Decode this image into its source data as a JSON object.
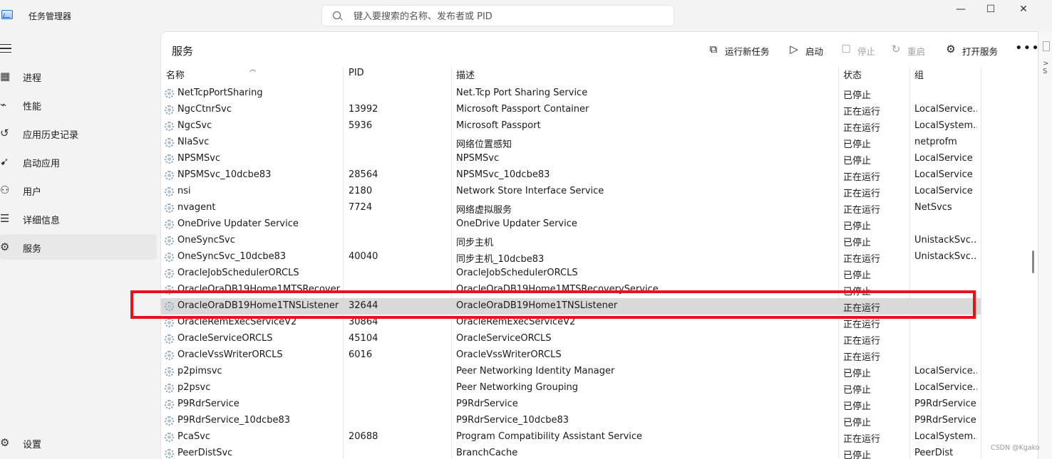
{
  "app": {
    "title": "任务管理器",
    "search_placeholder": "键入要搜索的名称、发布者或 PID",
    "window_controls": [
      "—",
      "☐",
      "✕"
    ]
  },
  "nav": {
    "items": [
      {
        "icon": "processes-icon",
        "label": "进程",
        "active": false
      },
      {
        "icon": "performance-icon",
        "label": "性能",
        "active": false
      },
      {
        "icon": "history-icon",
        "label": "应用历史记录",
        "active": false
      },
      {
        "icon": "startup-icon",
        "label": "启动应用",
        "active": false
      },
      {
        "icon": "users-icon",
        "label": "用户",
        "active": false
      },
      {
        "icon": "details-icon",
        "label": "详细信息",
        "active": false
      },
      {
        "icon": "services-icon",
        "label": "服务",
        "active": true
      }
    ],
    "settings_label": "设置"
  },
  "toolbar": {
    "page_title": "服务",
    "run_new_task": "运行新任务",
    "start": "启动",
    "stop": "停止",
    "restart": "重启",
    "open_services": "打开服务",
    "more": "•••"
  },
  "table": {
    "columns": [
      "名称",
      "PID",
      "描述",
      "状态",
      "组"
    ],
    "rows": [
      [
        "NetTcpPortSharing",
        "",
        "Net.Tcp Port Sharing Service",
        "已停止",
        ""
      ],
      [
        "NgcCtnrSvc",
        "13992",
        "Microsoft Passport Container",
        "正在运行",
        "LocalService..."
      ],
      [
        "NgcSvc",
        "5936",
        "Microsoft Passport",
        "正在运行",
        "LocalSystem..."
      ],
      [
        "NlaSvc",
        "",
        "网络位置感知",
        "已停止",
        "netprofm"
      ],
      [
        "NPSMSvc",
        "",
        "NPSMSvc",
        "已停止",
        "LocalService"
      ],
      [
        "NPSMSvc_10dcbe83",
        "28564",
        "NPSMSvc_10dcbe83",
        "正在运行",
        "LocalService"
      ],
      [
        "nsi",
        "2180",
        "Network Store Interface Service",
        "正在运行",
        "LocalService"
      ],
      [
        "nvagent",
        "7724",
        "网络虚拟服务",
        "正在运行",
        "NetSvcs"
      ],
      [
        "OneDrive Updater Service",
        "",
        "OneDrive Updater Service",
        "已停止",
        ""
      ],
      [
        "OneSyncSvc",
        "",
        "同步主机",
        "已停止",
        "UnistackSvc..."
      ],
      [
        "OneSyncSvc_10dcbe83",
        "40040",
        "同步主机_10dcbe83",
        "正在运行",
        "UnistackSvc..."
      ],
      [
        "OracleJobSchedulerORCLS",
        "",
        "OracleJobSchedulerORCLS",
        "已停止",
        ""
      ],
      [
        "OracleOraDB19Home1MTSRecover",
        "",
        "OracleOraDB19Home1MTSRecoveryService",
        "已停止",
        ""
      ],
      [
        "OracleOraDB19Home1TNSListener",
        "32644",
        "OracleOraDB19Home1TNSListener",
        "正在运行",
        ""
      ],
      [
        "OracleRemExecServiceV2",
        "30864",
        "OracleRemExecServiceV2",
        "正在运行",
        ""
      ],
      [
        "OracleServiceORCLS",
        "45104",
        "OracleServiceORCLS",
        "正在运行",
        ""
      ],
      [
        "OracleVssWriterORCLS",
        "6016",
        "OracleVssWriterORCLS",
        "正在运行",
        ""
      ],
      [
        "p2pimsvc",
        "",
        "Peer Networking Identity Manager",
        "已停止",
        "LocalService..."
      ],
      [
        "p2psvc",
        "",
        "Peer Networking Grouping",
        "已停止",
        "LocalService..."
      ],
      [
        "P9RdrService",
        "",
        "P9RdrService",
        "已停止",
        "P9RdrService"
      ],
      [
        "P9RdrService_10dcbe83",
        "",
        "P9RdrService_10dcbe83",
        "已停止",
        "P9RdrService"
      ],
      [
        "PcaSvc",
        "20688",
        "Program Compatibility Assistant Service",
        "正在运行",
        "LocalSystem..."
      ],
      [
        "PeerDistSvc",
        "",
        "BranchCache",
        "已停止",
        "PeerDist"
      ]
    ],
    "selected_row": 13
  },
  "watermark": "CSDN @Kgako",
  "colors": {
    "highlight_border": "#e8121e",
    "selected_row": "#d9d9d9"
  }
}
